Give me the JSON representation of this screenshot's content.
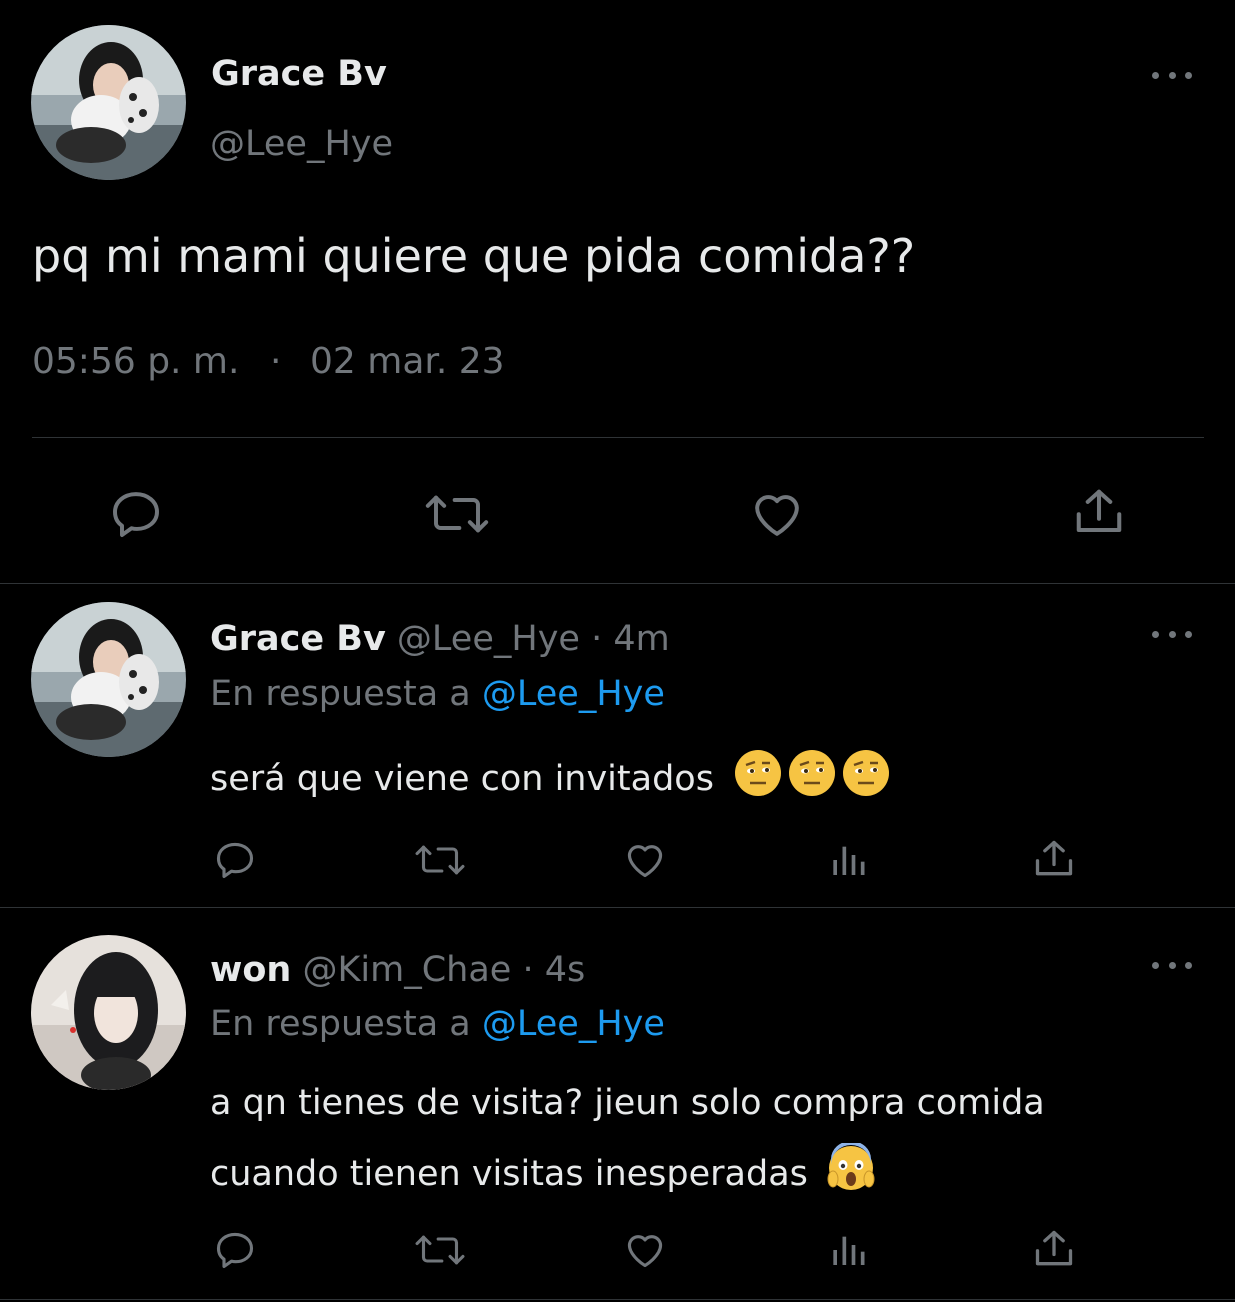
{
  "main_tweet": {
    "display_name": "Grace Bv",
    "handle": "@Lee_Hye",
    "text": "pq mi mami quiere que pida comida??",
    "time": "05:56 p. m.",
    "separator": "·",
    "date": "02 mar. 23"
  },
  "replies": [
    {
      "display_name": "Grace Bv",
      "handle": "@Lee_Hye",
      "age": "· 4m",
      "reply_prefix": "En respuesta a",
      "reply_to": "@Lee_Hye",
      "text": "será que viene con invitados",
      "emojis": [
        "face-with-raised-eyebrow-emoji",
        "face-with-raised-eyebrow-emoji",
        "face-with-raised-eyebrow-emoji"
      ]
    },
    {
      "display_name": "won",
      "handle": "@Kim_Chae",
      "age": "· 4s",
      "reply_prefix": "En respuesta a",
      "reply_to": "@Lee_Hye",
      "text_line1": "a qn tienes de visita? jieun solo compra comida",
      "text_line2": "cuando tienen visitas inesperadas",
      "emojis": [
        "face-screaming-in-fear-emoji"
      ]
    }
  ],
  "colors": {
    "background": "#000000",
    "text": "#e7e9ea",
    "muted": "#71767b",
    "link": "#1d9bf0",
    "divider": "#2f3336"
  },
  "icons": [
    "more-options-icon",
    "reply-icon",
    "retweet-icon",
    "like-icon",
    "share-icon",
    "views-icon"
  ]
}
